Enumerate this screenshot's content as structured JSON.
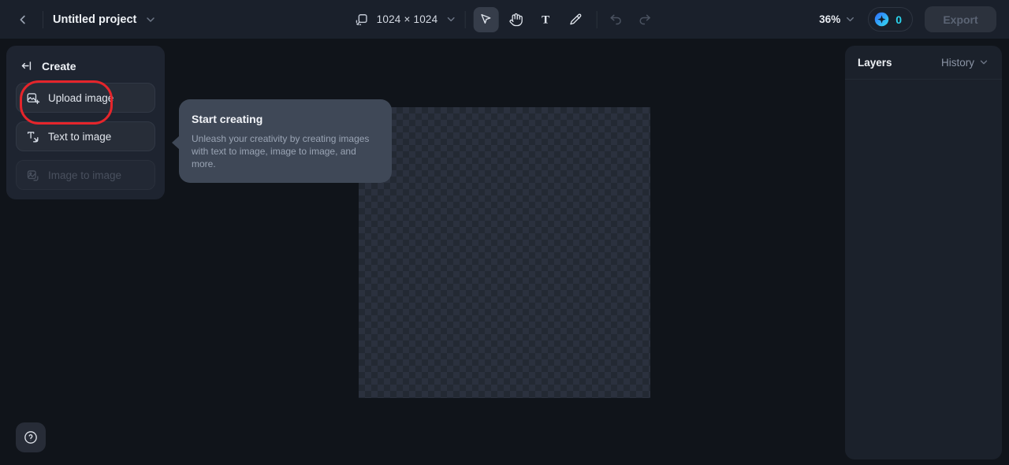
{
  "topbar": {
    "title": "Untitled project",
    "canvas_size": "1024 × 1024",
    "zoom_level": "36%",
    "credits_count": "0",
    "export_label": "Export"
  },
  "left_panel": {
    "title": "Create",
    "buttons": [
      {
        "label": "Upload image",
        "disabled": false
      },
      {
        "label": "Text to image",
        "disabled": false
      },
      {
        "label": "Image to image",
        "disabled": true
      }
    ]
  },
  "tooltip": {
    "title": "Start creating",
    "body": "Unleash your creativity by creating images with text to image, image to image, and more."
  },
  "right_panel": {
    "layers_label": "Layers",
    "history_label": "History"
  },
  "help": {
    "label": "?"
  },
  "colors": {
    "accent_cyan": "#2ad4ee",
    "annotation_red": "#e5252b",
    "checker_light": "#2b313e",
    "checker_dark": "#232933"
  }
}
